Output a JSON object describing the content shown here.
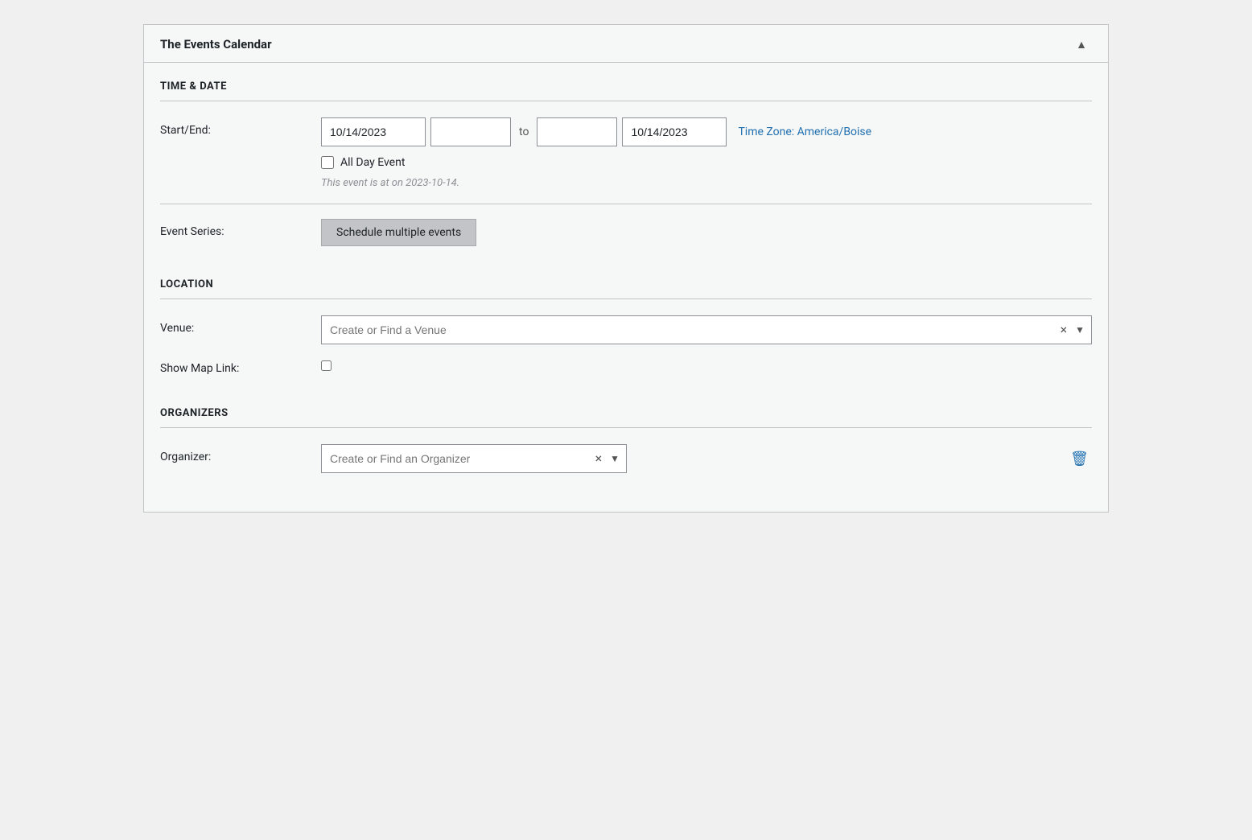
{
  "panel": {
    "title": "The Events Calendar",
    "toggle_icon": "▲"
  },
  "sections": {
    "time_date": {
      "heading": "TIME & DATE",
      "start_end_label": "Start/End:",
      "start_date": "10/14/2023",
      "start_time": "",
      "to_label": "to",
      "end_date": "10/14/2023",
      "end_time": "",
      "timezone_link": "Time Zone: America/Boise",
      "all_day_label": "All Day Event",
      "event_note": "This event is at on 2023-10-14.",
      "event_series_label": "Event Series:",
      "schedule_button": "Schedule multiple events"
    },
    "location": {
      "heading": "LOCATION",
      "venue_label": "Venue:",
      "venue_placeholder": "Create or Find a Venue",
      "show_map_label": "Show Map Link:"
    },
    "organizers": {
      "heading": "ORGANIZERS",
      "organizer_label": "Organizer:",
      "organizer_placeholder": "Create or Find an Organizer"
    }
  },
  "icons": {
    "clear": "×",
    "dropdown": "▼",
    "delete": "🗑"
  }
}
